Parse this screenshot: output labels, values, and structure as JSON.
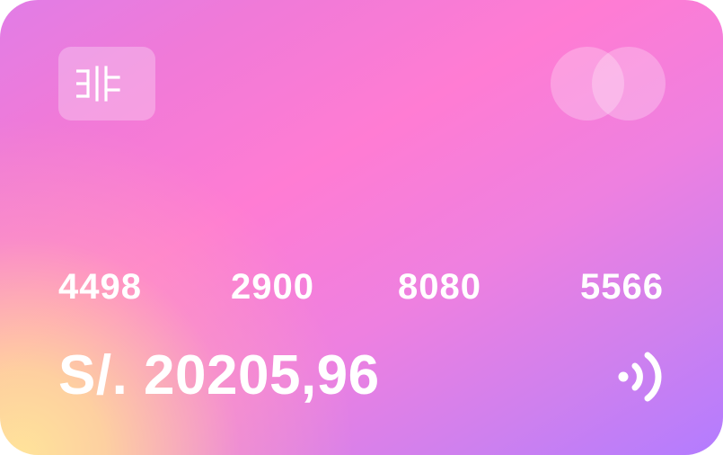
{
  "card": {
    "number_groups": [
      "4498",
      "2900",
      "8080",
      "5566"
    ],
    "balance": "S/. 20205,96"
  },
  "icons": {
    "logo": "bank-logo-icon",
    "network": "mastercard-logo-icon",
    "contactless": "contactless-icon"
  },
  "colors": {
    "pink": "#ff7cd3",
    "purple": "#b37cff",
    "yellow": "#ffe39a",
    "text": "#ffffff"
  }
}
